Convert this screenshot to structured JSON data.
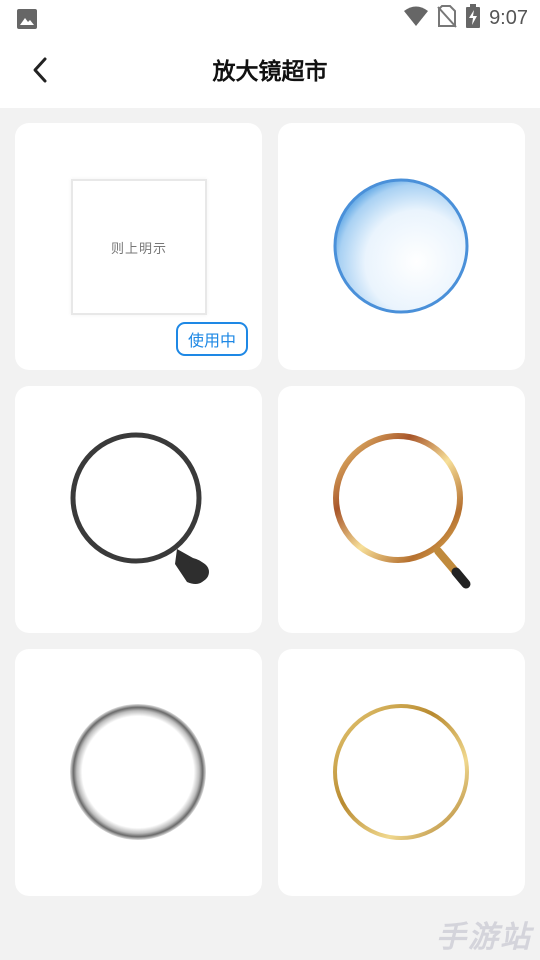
{
  "status_bar": {
    "time": "9:07",
    "icons": [
      "image-icon",
      "wifi-icon",
      "no-sim-icon",
      "battery-charging-icon"
    ]
  },
  "app_bar": {
    "title": "放大镜超市",
    "back_icon": "chevron-left-icon"
  },
  "magnifiers": [
    {
      "style": "plain-square",
      "preview_text": "则上明示",
      "badge": "使用中"
    },
    {
      "style": "blue-bubble"
    },
    {
      "style": "black-handle"
    },
    {
      "style": "gold-handle"
    },
    {
      "style": "silver-ring"
    },
    {
      "style": "gold-ring"
    }
  ],
  "watermark": "手游站",
  "colors": {
    "accent": "#1e88e5",
    "background": "#f2f2f2",
    "card": "#ffffff"
  }
}
